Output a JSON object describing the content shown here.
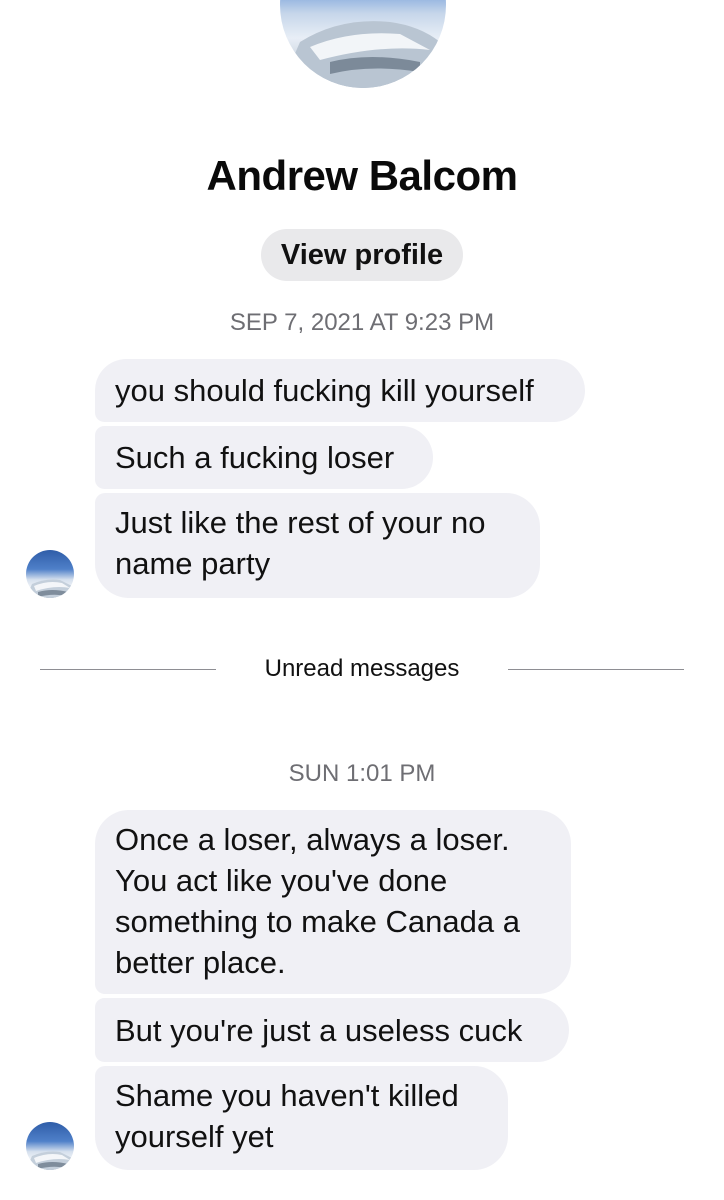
{
  "contact": {
    "name": "Andrew Balcom",
    "view_profile_label": "View profile",
    "avatar_icon": "avatar-photo"
  },
  "timestamps": {
    "first": "SEP 7, 2021 AT 9:23 PM",
    "second": "SUN 1:01 PM"
  },
  "divider": {
    "label": "Unread messages"
  },
  "messages": [
    "you should fucking kill yourself",
    "Such a fucking loser",
    "Just like the rest of your no name party",
    "Once a loser, always a loser. You act like you've done something to make Canada a better place.",
    "But you're just a useless cuck",
    "Shame you haven't killed yourself yet"
  ],
  "colors": {
    "bubble_bg": "#f0f0f5",
    "timestamp": "#6e6e73",
    "button_bg": "#e9e9eb"
  }
}
